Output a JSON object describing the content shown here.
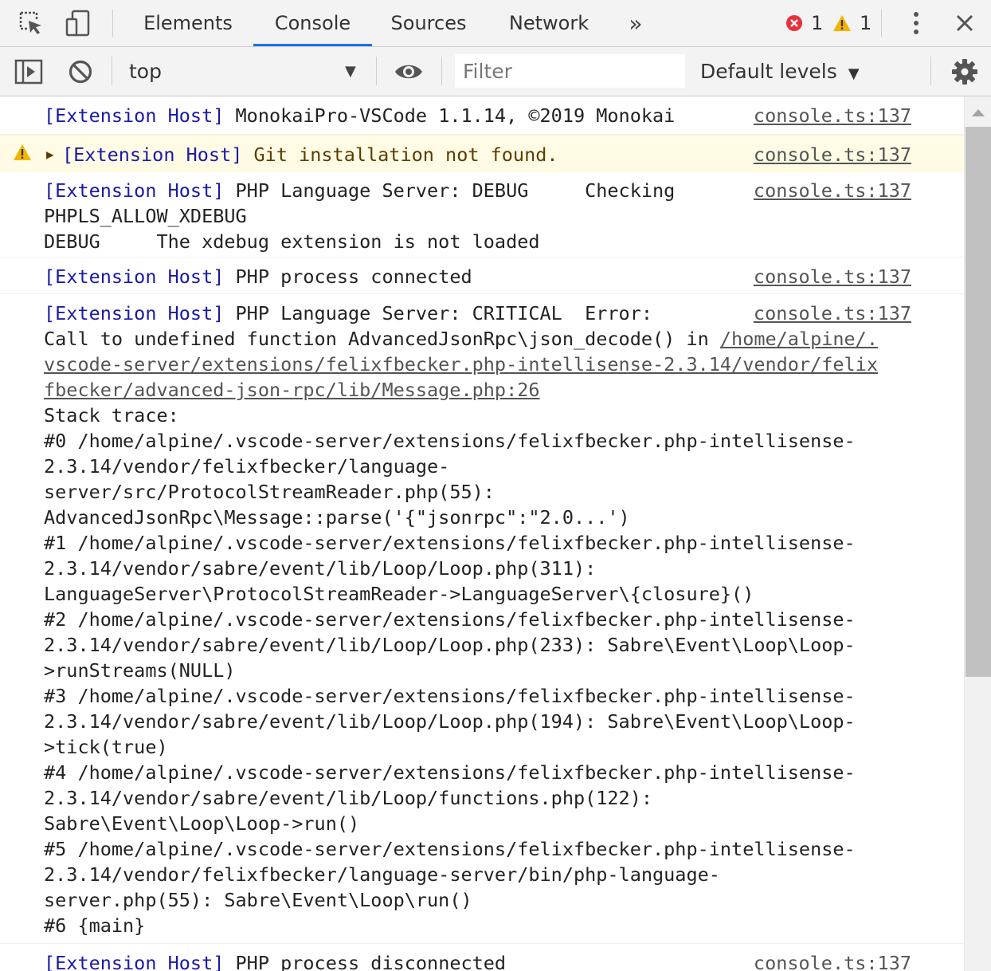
{
  "tabs": [
    {
      "label": "Elements"
    },
    {
      "label": "Console"
    },
    {
      "label": "Sources"
    },
    {
      "label": "Network"
    }
  ],
  "counters": {
    "errors": "1",
    "warnings": "1"
  },
  "toolbar": {
    "context": "top",
    "filter_placeholder": "Filter",
    "levels": "Default levels"
  },
  "colors": {
    "accent": "#1a73e8",
    "error": "#e8303a",
    "warning": "#f4b400",
    "tag": "#1a1aa6"
  },
  "messages": [
    {
      "tag": "[Extension Host]",
      "text": " MonokaiPro-VSCode 1.1.14, ©2019 Monokai",
      "source": "console.ts:137"
    },
    {
      "tag": "[Extension Host]",
      "text": " Git installation not found.",
      "source": "console.ts:137",
      "level": "warning"
    },
    {
      "tag": "[Extension Host]",
      "line1": " PHP Language Server: DEBUG     Checking",
      "line2": "PHPLS_ALLOW_XDEBUG",
      "line3": "DEBUG     The xdebug extension is not loaded",
      "source": "console.ts:137"
    },
    {
      "tag": "[Extension Host]",
      "text": " PHP process connected",
      "source": "console.ts:137"
    },
    {
      "tag": "[Extension Host]",
      "line1": " PHP Language Server: CRITICAL  Error:",
      "line2": "Call to undefined function AdvancedJsonRpc\\json_decode() in ",
      "link1": "/home/alpine/.",
      "link2": "vscode-server/extensions/felixfbecker.php-intellisense-2.3.14/vendor/felix",
      "link3": "fbecker/advanced-json-rpc/lib/Message.php:26",
      "trace": "Stack trace:\n#0 /home/alpine/.vscode-server/extensions/felixfbecker.php-intellisense-\n2.3.14/vendor/felixfbecker/language-\nserver/src/ProtocolStreamReader.php(55):\nAdvancedJsonRpc\\Message::parse('{\"jsonrpc\":\"2.0...')\n#1 /home/alpine/.vscode-server/extensions/felixfbecker.php-intellisense-\n2.3.14/vendor/sabre/event/lib/Loop/Loop.php(311):\nLanguageServer\\ProtocolStreamReader->LanguageServer\\{closure}()\n#2 /home/alpine/.vscode-server/extensions/felixfbecker.php-intellisense-\n2.3.14/vendor/sabre/event/lib/Loop/Loop.php(233): Sabre\\Event\\Loop\\Loop-\n>runStreams(NULL)\n#3 /home/alpine/.vscode-server/extensions/felixfbecker.php-intellisense-\n2.3.14/vendor/sabre/event/lib/Loop/Loop.php(194): Sabre\\Event\\Loop\\Loop-\n>tick(true)\n#4 /home/alpine/.vscode-server/extensions/felixfbecker.php-intellisense-\n2.3.14/vendor/sabre/event/lib/Loop/functions.php(122):\nSabre\\Event\\Loop\\Loop->run()\n#5 /home/alpine/.vscode-server/extensions/felixfbecker.php-intellisense-\n2.3.14/vendor/felixfbecker/language-server/bin/php-language-\nserver.php(55): Sabre\\Event\\Loop\\run()\n#6 {main}",
      "source": "console.ts:137"
    },
    {
      "tag": "[Extension Host]",
      "text": " PHP process disconnected",
      "source": "console.ts:137"
    }
  ]
}
